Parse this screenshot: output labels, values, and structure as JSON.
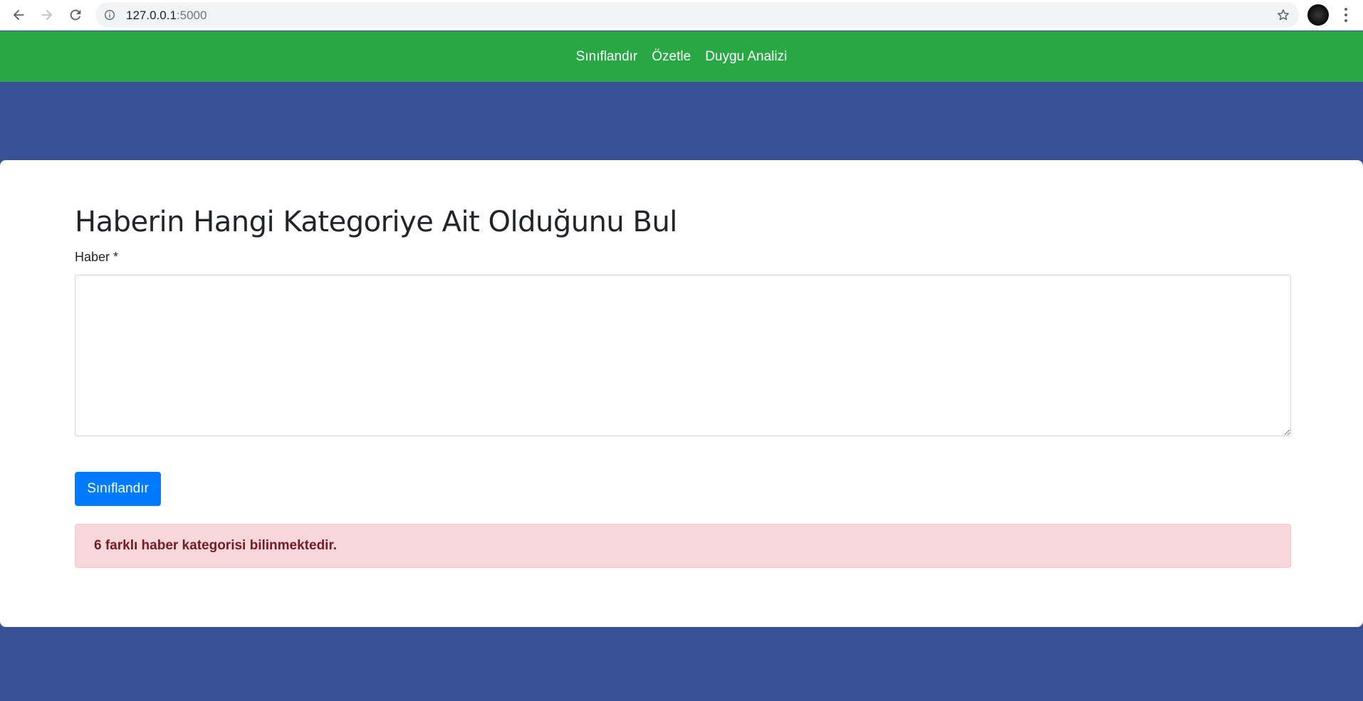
{
  "browser": {
    "url_host": "127.0.0.1",
    "url_port": ":5000"
  },
  "nav": {
    "items": [
      "Sınıflandır",
      "Özetle",
      "Duygu Analizi"
    ]
  },
  "main": {
    "title": "Haberin Hangi Kategoriye Ait Olduğunu Bul",
    "field_label": "Haber *",
    "textarea_value": "",
    "submit_label": "Sınıflandır",
    "alert_text": "6 farklı haber kategorisi bilinmektedir."
  },
  "colors": {
    "nav_bg": "#28a745",
    "page_bg": "#385196",
    "button_bg": "#007bff",
    "alert_bg": "#f8d7da",
    "alert_text": "#721c24"
  },
  "icons": [
    "back-arrow-icon",
    "forward-arrow-icon",
    "reload-icon",
    "info-icon",
    "star-icon",
    "profile-avatar",
    "more-vert-icon"
  ]
}
